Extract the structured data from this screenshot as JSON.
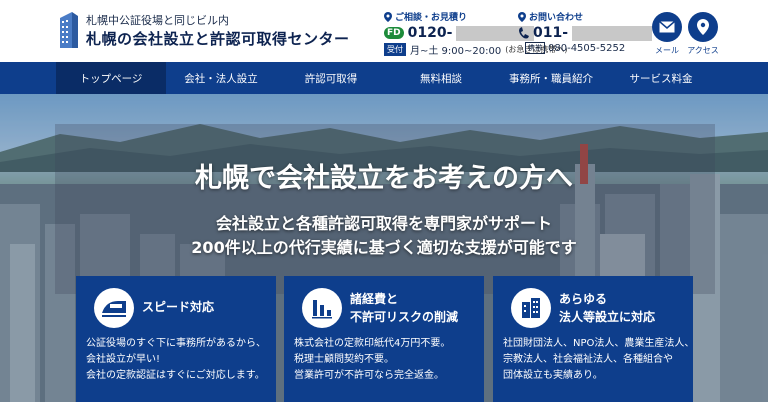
{
  "header": {
    "brand_sub": "札幌中公証役場と同じビル内",
    "brand_main": "札幌の会社設立と許認可取得センター",
    "consult_label": "ご相談・お見積り",
    "consult_number_prefix": "0120-",
    "freedial_badge": "FD",
    "inquiry_label": "お問い合わせ",
    "inquiry_number_prefix": "011-",
    "hours_badge": "受付",
    "hours_text": "月~土 9:00~20:00",
    "hours_note": "(お急ぎは携帯へ)",
    "fax_badge": "携帯",
    "mobile_number": "080-4505-5252",
    "mail_label": "メール",
    "access_label": "アクセス"
  },
  "nav": {
    "items": [
      {
        "label": "トップページ",
        "active": true
      },
      {
        "label": "会社・法人設立",
        "active": false
      },
      {
        "label": "許認可取得",
        "active": false
      },
      {
        "label": "無料相談",
        "active": false
      },
      {
        "label": "事務所・職員紹介",
        "active": false
      },
      {
        "label": "サービス料金",
        "active": false
      }
    ]
  },
  "hero": {
    "title": "札幌で会社設立をお考えの方へ",
    "sub1": "会社設立と各種許認可取得を専門家がサポート",
    "sub2": "200件以上の代行実績に基づく適切な支援が可能です"
  },
  "cards": [
    {
      "title_lines": [
        "スピード対応"
      ],
      "icon": "train-icon",
      "body_lines": [
        "公証役場のすぐ下に事務所があるから、",
        "会社設立が早い!",
        "会社の定款認証はすぐにご対応します。"
      ]
    },
    {
      "title_lines": [
        "諸経費と",
        "不許可リスクの削減"
      ],
      "icon": "chart-down-icon",
      "body_lines": [
        "株式会社の定款印紙代4万円不要。",
        "税理士顧問契約不要。",
        "営業許可が不許可なら完全返金。"
      ]
    },
    {
      "title_lines": [
        "あらゆる",
        "法人等設立に対応"
      ],
      "icon": "building-icon",
      "body_lines": [
        "社団財団法人、NPO法人、農業生産法人、",
        "宗教法人、社会福祉法人、各種組合や",
        "団体設立も実績あり。"
      ]
    }
  ],
  "colors": {
    "primary": "#0e3e8c",
    "nav_active": "#0a2c66",
    "freedial": "#1c8b3a"
  }
}
